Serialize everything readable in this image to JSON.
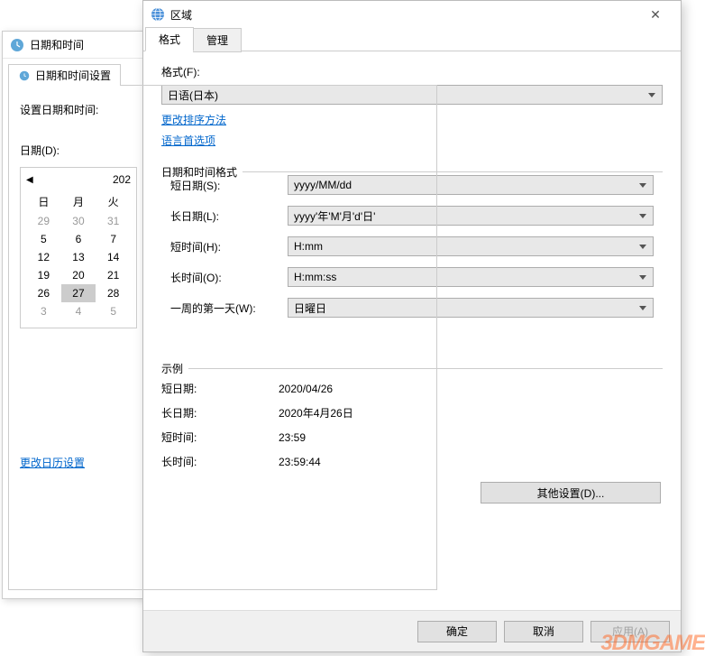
{
  "back_window": {
    "title": "日期和时间",
    "tab_label": "日期和时间设置",
    "set_datetime_label": "设置日期和时间:",
    "date_label": "日期(D):",
    "calendar": {
      "month_year": "202",
      "weekdays": [
        "日",
        "月",
        "火"
      ],
      "rows": [
        [
          "29",
          "30",
          "31"
        ],
        [
          "5",
          "6",
          "7"
        ],
        [
          "12",
          "13",
          "14"
        ],
        [
          "19",
          "20",
          "21"
        ],
        [
          "26",
          "27",
          "28"
        ],
        [
          "3",
          "4",
          "5"
        ]
      ],
      "gray_rows": [
        0,
        5
      ],
      "selected": "27"
    },
    "change_calendar_link": "更改日历设置"
  },
  "front_window": {
    "title": "区域",
    "tabs": {
      "format": "格式",
      "admin": "管理"
    },
    "format_label": "格式(F):",
    "format_value": "日语(日本)",
    "sort_link": "更改排序方法",
    "lang_link": "语言首选项",
    "dt_format_legend": "日期和时间格式",
    "short_date_label": "短日期(S):",
    "short_date_value": "yyyy/MM/dd",
    "long_date_label": "长日期(L):",
    "long_date_value": "yyyy'年'M'月'd'日'",
    "short_time_label": "短时间(H):",
    "short_time_value": "H:mm",
    "long_time_label": "长时间(O):",
    "long_time_value": "H:mm:ss",
    "first_day_label": "一周的第一天(W):",
    "first_day_value": "日曜日",
    "example_legend": "示例",
    "ex_short_date_label": "短日期:",
    "ex_short_date_value": "2020/04/26",
    "ex_long_date_label": "长日期:",
    "ex_long_date_value": "2020年4月26日",
    "ex_short_time_label": "短时间:",
    "ex_short_time_value": "23:59",
    "ex_long_time_label": "长时间:",
    "ex_long_time_value": "23:59:44",
    "other_settings_btn": "其他设置(D)...",
    "ok_btn": "确定",
    "cancel_btn": "取消",
    "apply_btn": "应用(A)"
  },
  "watermark": "3DMGAME"
}
